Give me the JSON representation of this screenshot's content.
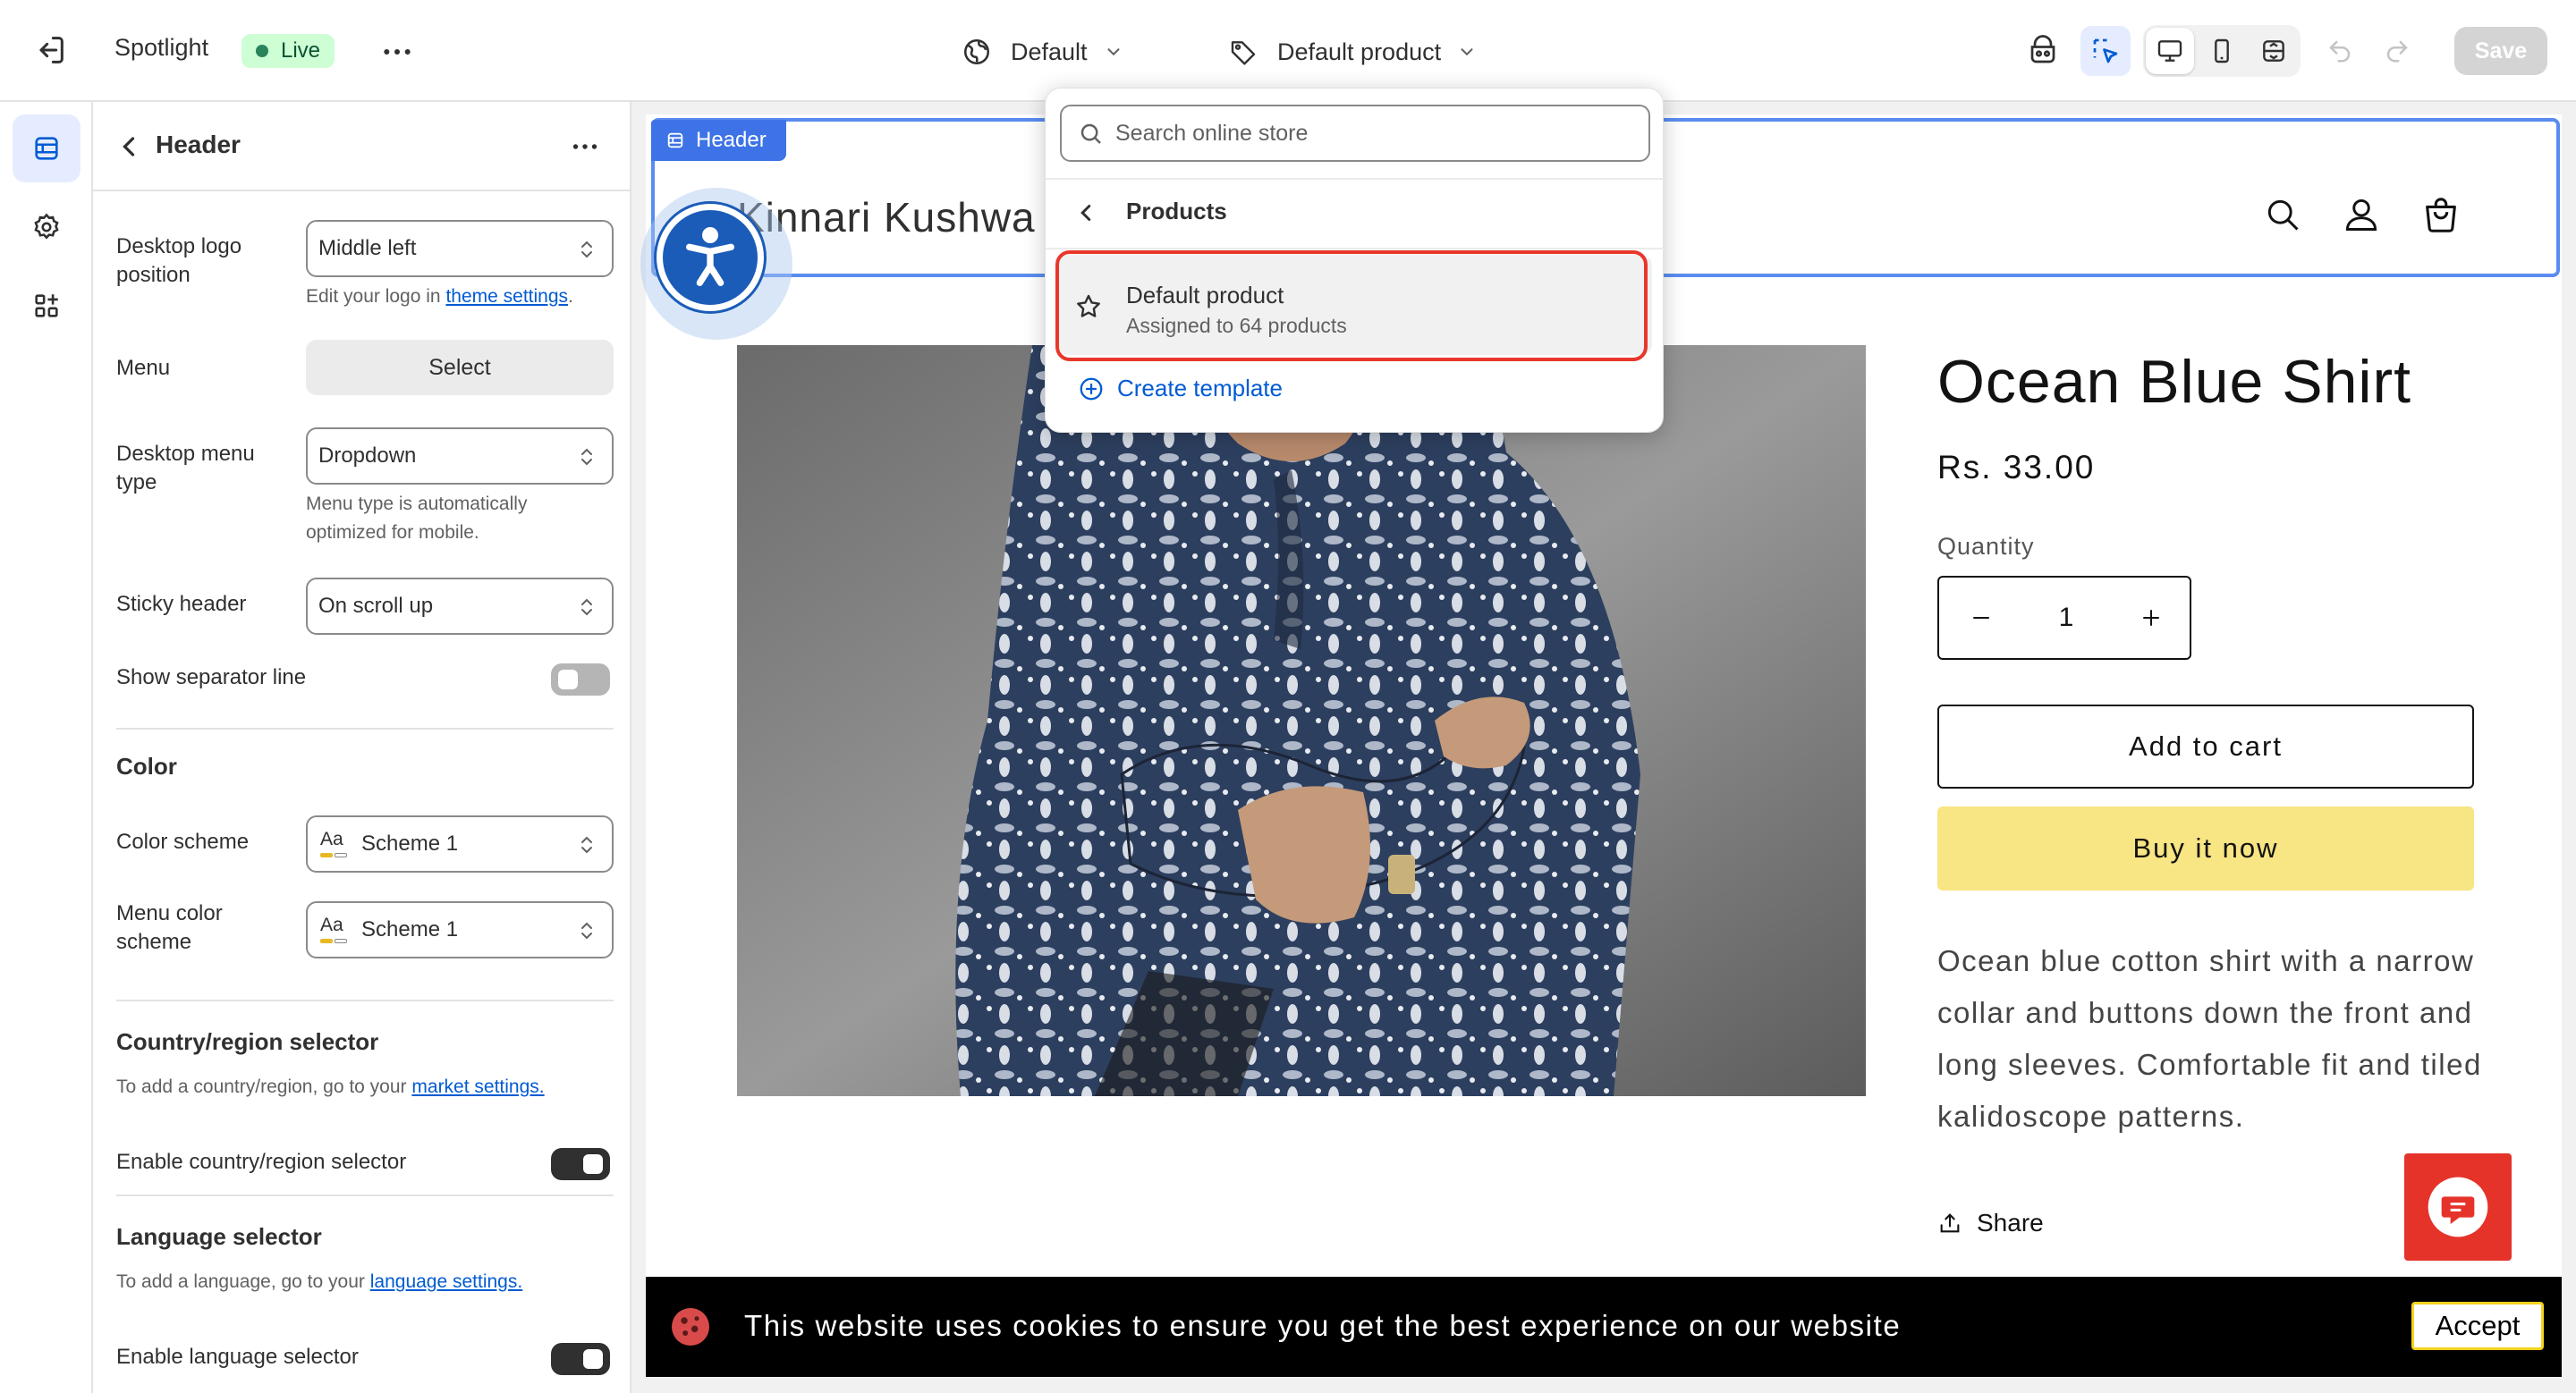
{
  "topbar": {
    "title": "Spotlight",
    "status": "Live",
    "theme_label": "Default",
    "template_label": "Default product",
    "save_label": "Save"
  },
  "panel": {
    "title": "Header",
    "desktop_logo_position": {
      "label": "Desktop logo position",
      "value": "Middle left",
      "help_prefix": "Edit your logo in",
      "help_link": "theme settings",
      "help_suffix": "."
    },
    "menu": {
      "label": "Menu",
      "button": "Select"
    },
    "desktop_menu_type": {
      "label": "Desktop menu type",
      "value": "Dropdown",
      "help": "Menu type is automatically optimized for mobile."
    },
    "sticky_header": {
      "label": "Sticky header",
      "value": "On scroll up"
    },
    "show_separator": {
      "label": "Show separator line",
      "on": false
    },
    "color": {
      "title": "Color",
      "scheme_label": "Color scheme",
      "scheme_value": "Scheme 1",
      "menu_scheme_label": "Menu color scheme",
      "menu_scheme_value": "Scheme 1",
      "aa": "Aa"
    },
    "country": {
      "title": "Country/region selector",
      "help_prefix": "To add a country/region, go to your",
      "help_link": "market settings.",
      "toggle_label": "Enable country/region selector",
      "on": true
    },
    "language": {
      "title": "Language selector",
      "help_prefix": "To add a language, go to your",
      "help_link": "language settings.",
      "toggle_label": "Enable language selector",
      "on": true
    }
  },
  "preview": {
    "header_tag": "Header",
    "store_name": "Kinnari Kushwa",
    "product": {
      "title": "Ocean Blue Shirt",
      "price": "Rs. 33.00",
      "quantity_label": "Quantity",
      "quantity": "1",
      "add_to_cart": "Add to cart",
      "buy_now": "Buy it now",
      "description": "Ocean blue cotton shirt with a narrow collar and buttons down the front and long sleeves. Comfortable fit and tiled kalidoscope patterns.",
      "share": "Share"
    },
    "cookie": {
      "text": "This website uses cookies to ensure you get the best experience on our website",
      "accept": "Accept"
    }
  },
  "dropdown": {
    "search_placeholder": "Search online store",
    "section": "Products",
    "item_title": "Default product",
    "item_sub": "Assigned to 64 products",
    "create": "Create template"
  },
  "colors": {
    "accent": "#005bd3",
    "highlight": "#e8372b",
    "buy_now": "#f8e583",
    "header_outline": "#5a8cf0"
  }
}
